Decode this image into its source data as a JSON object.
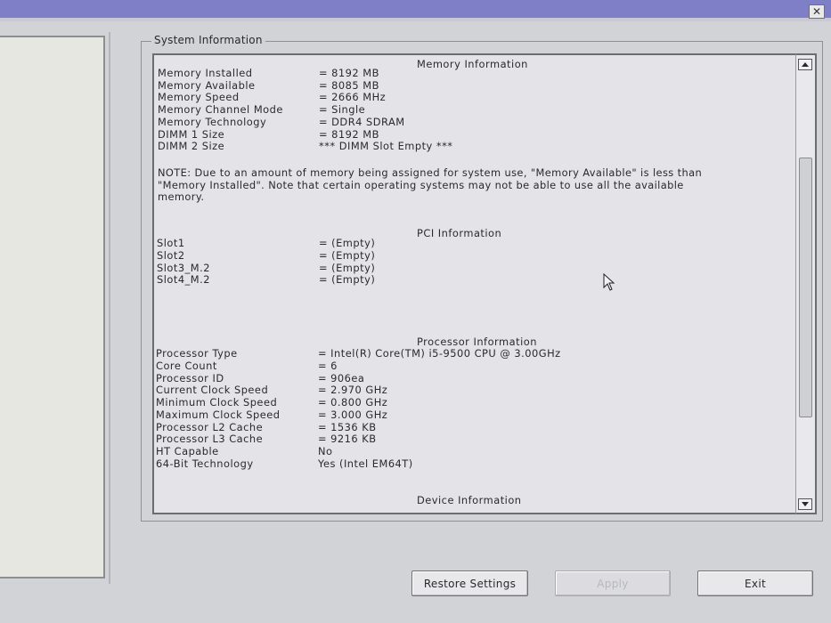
{
  "window": {
    "close_glyph": "✕"
  },
  "group_title": "System Information",
  "memory": {
    "header": "Memory Information",
    "rows": [
      {
        "label": "Memory Installed",
        "value": "= 8192 MB"
      },
      {
        "label": "Memory Available",
        "value": "= 8085 MB"
      },
      {
        "label": "Memory Speed",
        "value": "= 2666 MHz"
      },
      {
        "label": "Memory Channel Mode",
        "value": "= Single"
      },
      {
        "label": "Memory Technology",
        "value": "= DDR4 SDRAM"
      },
      {
        "label": "DIMM 1 Size",
        "value": "= 8192 MB"
      },
      {
        "label": "DIMM 2 Size",
        "value": "*** DIMM Slot Empty ***"
      }
    ],
    "note": "NOTE: Due to an amount of memory being assigned for system use, \"Memory Available\" is less than \"Memory Installed\". Note that certain operating systems may not be able to use all the available memory."
  },
  "pci": {
    "header": "PCI Information",
    "rows": [
      {
        "label": "Slot1",
        "value": "= (Empty)"
      },
      {
        "label": "Slot2",
        "value": "= (Empty)"
      },
      {
        "label": "Slot3_M.2",
        "value": "= (Empty)"
      },
      {
        "label": "Slot4_M.2",
        "value": "= (Empty)"
      }
    ]
  },
  "processor": {
    "header": "Processor Information",
    "rows": [
      {
        "label": "Processor Type",
        "value": "= Intel(R) Core(TM) i5-9500 CPU @ 3.00GHz"
      },
      {
        "label": "Core Count",
        "value": "= 6"
      },
      {
        "label": "Processor ID",
        "value": "= 906ea"
      },
      {
        "label": "Current Clock Speed",
        "value": "= 2.970 GHz"
      },
      {
        "label": "Minimum Clock Speed",
        "value": "= 0.800 GHz"
      },
      {
        "label": "Maximum Clock Speed",
        "value": "= 3.000 GHz"
      },
      {
        "label": "Processor L2 Cache",
        "value": "= 1536 KB"
      },
      {
        "label": "Processor L3 Cache",
        "value": "= 9216 KB"
      },
      {
        "label": "HT Capable",
        "value": "No"
      },
      {
        "label": "64-Bit Technology",
        "value": "Yes (Intel EM64T)"
      }
    ]
  },
  "device": {
    "header": "Device Information"
  },
  "buttons": {
    "restore": "Restore Settings",
    "apply": "Apply",
    "exit": "Exit"
  },
  "icons": {
    "close": "close-icon",
    "scroll_up": "scroll-up-icon",
    "scroll_down": "scroll-down-icon",
    "cursor": "mouse-pointer-icon"
  }
}
